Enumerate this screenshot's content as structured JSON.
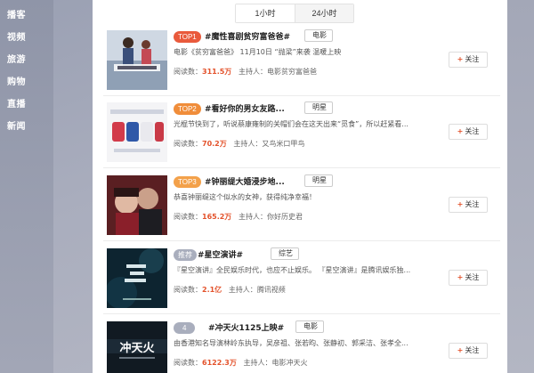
{
  "sidebar": {
    "items": [
      {
        "label": "播客"
      },
      {
        "label": "视频"
      },
      {
        "label": "旅游"
      },
      {
        "label": "购物"
      },
      {
        "label": "直播"
      },
      {
        "label": "新闻"
      }
    ]
  },
  "tabs": [
    {
      "label": "1小时",
      "active": true
    },
    {
      "label": "24小时",
      "active": false
    }
  ],
  "labels": {
    "reads": "阅读数：",
    "host": "主持人：",
    "follow": "关注",
    "follow_icon": "plus-icon"
  },
  "colors": {
    "top1": "#e95a3c",
    "top2": "#f08d3a",
    "top3": "#f3a14a",
    "recommend": "#a9aebd",
    "rank4": "#a9aebd",
    "accent": "#e3522b"
  },
  "topics": [
    {
      "rank": "TOP1",
      "title": "#魔性喜剧贫穷富爸爸#",
      "category": "电影",
      "desc": "电影《贫穷富爸爸》 11月10日 “抛梁”来袭 温暖上映",
      "reads": "311.5万",
      "host": "电影贫穷富爸爸"
    },
    {
      "rank": "TOP2",
      "title": "#看好你的男女友路...",
      "category": "明星",
      "desc": "光棍节快到了，听说蔡康雍制的关帽们会在这天出来“觅食”，所以赶紧看...",
      "reads": "70.2万",
      "host": "又鸟米口甲鸟"
    },
    {
      "rank": "TOP3",
      "title": "#钟丽缇大婚浸步地...",
      "category": "明星",
      "desc": "恭喜钟丽缇这个似水的女神，获得纯净幸福！",
      "reads": "165.2万",
      "host": "你好历史君"
    },
    {
      "rank": "推荐",
      "title": "#星空演讲#",
      "category": "综艺",
      "desc": "『星空演讲』全民娱乐时代，也应不止娱乐。 『星空演讲』是腾讯娱乐独...",
      "reads": "2.1亿",
      "host": "腾讯视频"
    },
    {
      "rank": "4",
      "title": "#冲天火1125上映#",
      "category": "电影",
      "desc": "由香港知名导演林岭东执导，吴彦祖、张若昀、张静初、郭采洁、张孝全...",
      "reads": "6122.3万",
      "host": "电影冲天火"
    }
  ]
}
